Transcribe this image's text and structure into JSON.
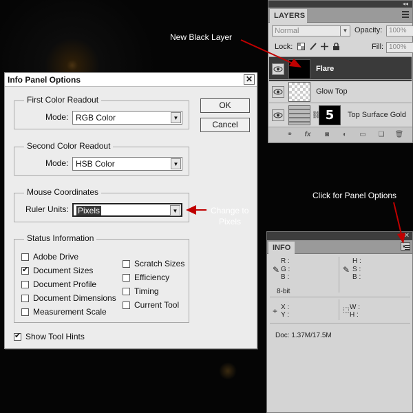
{
  "layers_panel": {
    "tab": "LAYERS",
    "blend_mode": "Normal",
    "opacity_label": "Opacity:",
    "opacity_value": "100%",
    "lock_label": "Lock:",
    "fill_label": "Fill:",
    "fill_value": "100%",
    "layers": [
      {
        "name": "Flare",
        "selected": true
      },
      {
        "name": "Glow Top",
        "selected": false
      },
      {
        "name": "Top Surface Gold",
        "selected": false,
        "mask_glyph": "5"
      }
    ]
  },
  "dialog": {
    "title": "Info Panel Options",
    "close": "✕",
    "ok": "OK",
    "cancel": "Cancel",
    "first_readout": {
      "title": "First Color Readout",
      "mode_label": "Mode:",
      "mode_value": "RGB Color"
    },
    "second_readout": {
      "title": "Second Color Readout",
      "mode_label": "Mode:",
      "mode_value": "HSB Color"
    },
    "mouse": {
      "title": "Mouse Coordinates",
      "units_label": "Ruler Units:",
      "units_value": "Pixels"
    },
    "status": {
      "title": "Status Information",
      "left": [
        {
          "label": "Adobe Drive",
          "checked": false
        },
        {
          "label": "Document Sizes",
          "checked": true
        },
        {
          "label": "Document Profile",
          "checked": false
        },
        {
          "label": "Document Dimensions",
          "checked": false
        },
        {
          "label": "Measurement Scale",
          "checked": false
        }
      ],
      "right": [
        {
          "label": "Scratch Sizes",
          "checked": false
        },
        {
          "label": "Efficiency",
          "checked": false
        },
        {
          "label": "Timing",
          "checked": false
        },
        {
          "label": "Current Tool",
          "checked": false
        }
      ]
    },
    "tool_hints": {
      "label": "Show Tool Hints",
      "checked": true
    }
  },
  "info_panel": {
    "tab": "INFO",
    "close": "✕",
    "r": "R :",
    "g": "G :",
    "b": "B :",
    "h": "H :",
    "s": "S :",
    "b2": "B :",
    "bit": "8-bit",
    "x": "X :",
    "y": "Y :",
    "w": "W :",
    "h2": "H :",
    "doc": "Doc: 1.37M/17.5M"
  },
  "annotations": {
    "new_layer": "New Black Layer",
    "panel_options": "Click for Panel Options",
    "change_to_line1": "Change to",
    "change_to_line2": "Pixels"
  },
  "colors": {
    "arrow": "#c00000",
    "selected_layer": "#3a3a3a"
  }
}
